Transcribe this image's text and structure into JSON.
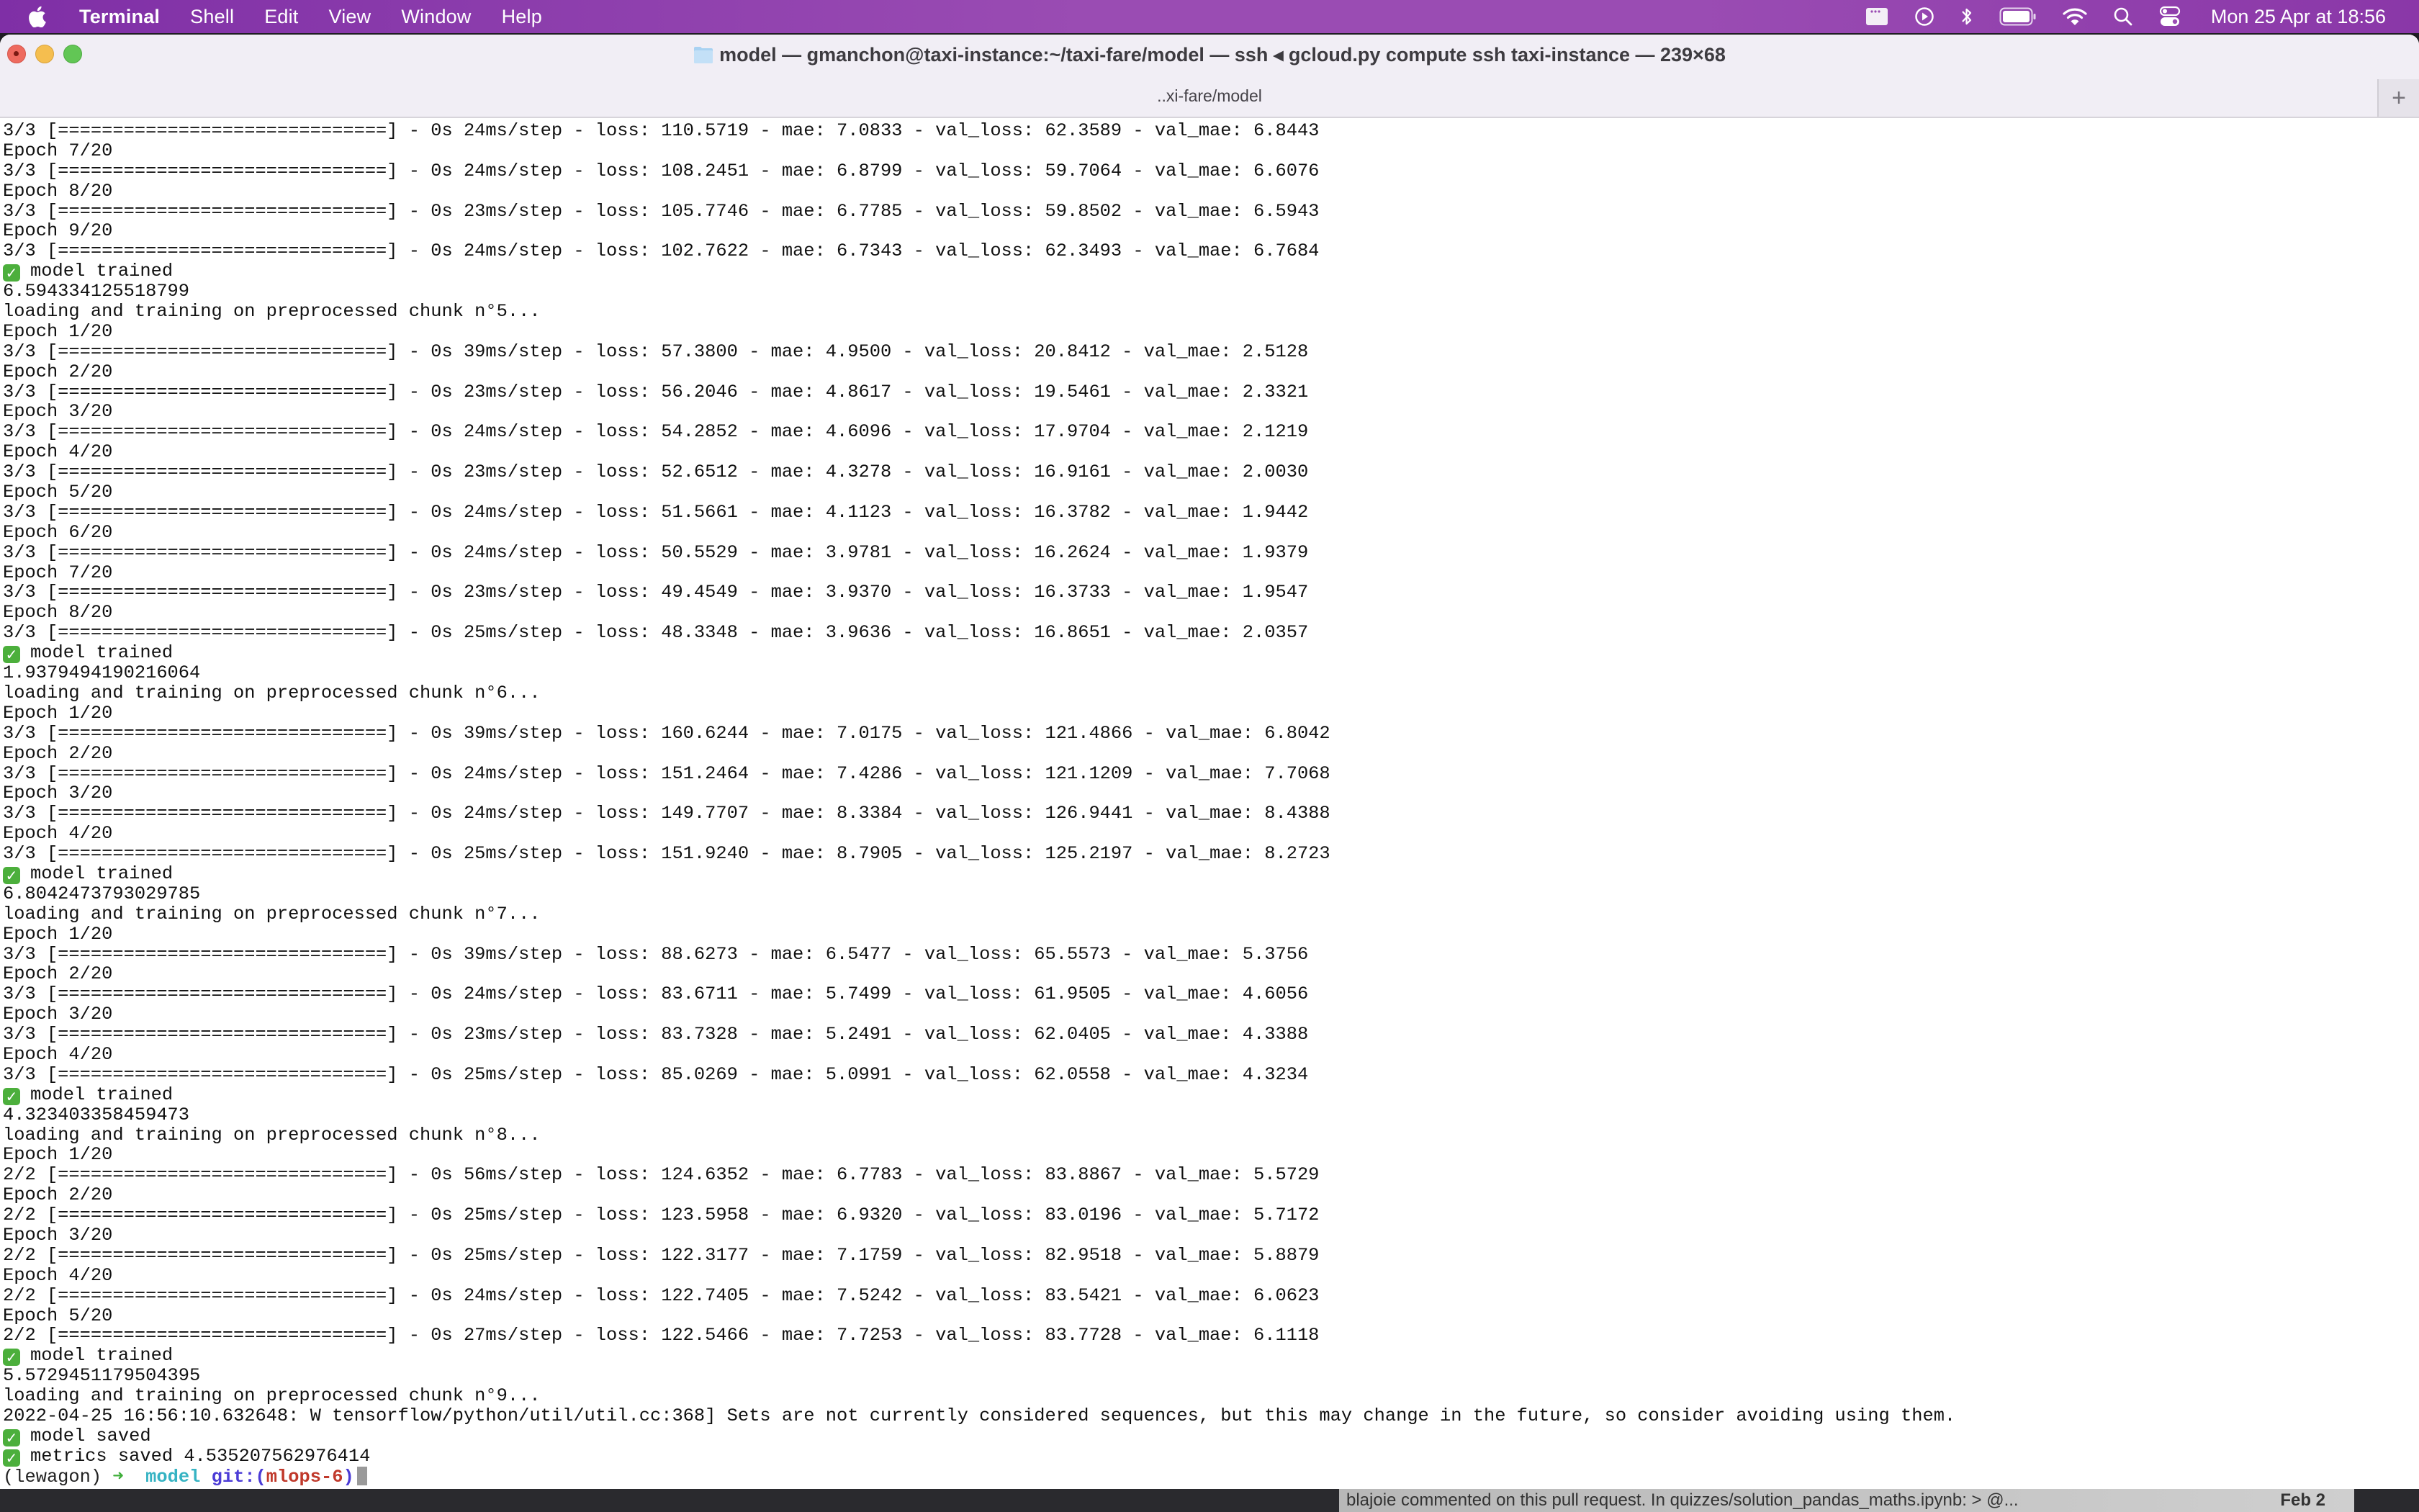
{
  "menubar": {
    "app_name": "Terminal",
    "menus": [
      "Shell",
      "Edit",
      "View",
      "Window",
      "Help"
    ],
    "status_icons": [
      "window-icon",
      "play-circle-icon",
      "bluetooth-icon",
      "battery-icon",
      "wifi-icon",
      "search-icon",
      "control-center-icon"
    ],
    "clock": "Mon 25 Apr at  18:56"
  },
  "window": {
    "title": "model — gmanchon@taxi-instance:~/taxi-fare/model — ssh ◂ gcloud.py compute ssh taxi-instance — 239×68",
    "tab_label": "..xi-fare/model",
    "new_tab_label": "+"
  },
  "terminal": {
    "lines": [
      {
        "text": "3/3 [==============================] - 0s 24ms/step - loss: 110.5719 - mae: 7.0833 - val_loss: 62.3589 - val_mae: 6.8443"
      },
      {
        "text": "Epoch 7/20"
      },
      {
        "text": "3/3 [==============================] - 0s 24ms/step - loss: 108.2451 - mae: 6.8799 - val_loss: 59.7064 - val_mae: 6.6076"
      },
      {
        "text": "Epoch 8/20"
      },
      {
        "text": "3/3 [==============================] - 0s 23ms/step - loss: 105.7746 - mae: 6.7785 - val_loss: 59.8502 - val_mae: 6.5943"
      },
      {
        "text": "Epoch 9/20"
      },
      {
        "text": "3/3 [==============================] - 0s 24ms/step - loss: 102.7622 - mae: 6.7343 - val_loss: 62.3493 - val_mae: 6.7684"
      },
      {
        "text": "model trained",
        "check": true
      },
      {
        "text": "6.594334125518799"
      },
      {
        "text": "loading and training on preprocessed chunk n°5..."
      },
      {
        "text": "Epoch 1/20"
      },
      {
        "text": "3/3 [==============================] - 0s 39ms/step - loss: 57.3800 - mae: 4.9500 - val_loss: 20.8412 - val_mae: 2.5128"
      },
      {
        "text": "Epoch 2/20"
      },
      {
        "text": "3/3 [==============================] - 0s 23ms/step - loss: 56.2046 - mae: 4.8617 - val_loss: 19.5461 - val_mae: 2.3321"
      },
      {
        "text": "Epoch 3/20"
      },
      {
        "text": "3/3 [==============================] - 0s 24ms/step - loss: 54.2852 - mae: 4.6096 - val_loss: 17.9704 - val_mae: 2.1219"
      },
      {
        "text": "Epoch 4/20"
      },
      {
        "text": "3/3 [==============================] - 0s 23ms/step - loss: 52.6512 - mae: 4.3278 - val_loss: 16.9161 - val_mae: 2.0030"
      },
      {
        "text": "Epoch 5/20"
      },
      {
        "text": "3/3 [==============================] - 0s 24ms/step - loss: 51.5661 - mae: 4.1123 - val_loss: 16.3782 - val_mae: 1.9442"
      },
      {
        "text": "Epoch 6/20"
      },
      {
        "text": "3/3 [==============================] - 0s 24ms/step - loss: 50.5529 - mae: 3.9781 - val_loss: 16.2624 - val_mae: 1.9379"
      },
      {
        "text": "Epoch 7/20"
      },
      {
        "text": "3/3 [==============================] - 0s 23ms/step - loss: 49.4549 - mae: 3.9370 - val_loss: 16.3733 - val_mae: 1.9547"
      },
      {
        "text": "Epoch 8/20"
      },
      {
        "text": "3/3 [==============================] - 0s 25ms/step - loss: 48.3348 - mae: 3.9636 - val_loss: 16.8651 - val_mae: 2.0357"
      },
      {
        "text": "model trained",
        "check": true
      },
      {
        "text": "1.9379494190216064"
      },
      {
        "text": "loading and training on preprocessed chunk n°6..."
      },
      {
        "text": "Epoch 1/20"
      },
      {
        "text": "3/3 [==============================] - 0s 39ms/step - loss: 160.6244 - mae: 7.0175 - val_loss: 121.4866 - val_mae: 6.8042"
      },
      {
        "text": "Epoch 2/20"
      },
      {
        "text": "3/3 [==============================] - 0s 24ms/step - loss: 151.2464 - mae: 7.4286 - val_loss: 121.1209 - val_mae: 7.7068"
      },
      {
        "text": "Epoch 3/20"
      },
      {
        "text": "3/3 [==============================] - 0s 24ms/step - loss: 149.7707 - mae: 8.3384 - val_loss: 126.9441 - val_mae: 8.4388"
      },
      {
        "text": "Epoch 4/20"
      },
      {
        "text": "3/3 [==============================] - 0s 25ms/step - loss: 151.9240 - mae: 8.7905 - val_loss: 125.2197 - val_mae: 8.2723"
      },
      {
        "text": "model trained",
        "check": true
      },
      {
        "text": "6.8042473793029785"
      },
      {
        "text": "loading and training on preprocessed chunk n°7..."
      },
      {
        "text": "Epoch 1/20"
      },
      {
        "text": "3/3 [==============================] - 0s 39ms/step - loss: 88.6273 - mae: 6.5477 - val_loss: 65.5573 - val_mae: 5.3756"
      },
      {
        "text": "Epoch 2/20"
      },
      {
        "text": "3/3 [==============================] - 0s 24ms/step - loss: 83.6711 - mae: 5.7499 - val_loss: 61.9505 - val_mae: 4.6056"
      },
      {
        "text": "Epoch 3/20"
      },
      {
        "text": "3/3 [==============================] - 0s 23ms/step - loss: 83.7328 - mae: 5.2491 - val_loss: 62.0405 - val_mae: 4.3388"
      },
      {
        "text": "Epoch 4/20"
      },
      {
        "text": "3/3 [==============================] - 0s 25ms/step - loss: 85.0269 - mae: 5.0991 - val_loss: 62.0558 - val_mae: 4.3234"
      },
      {
        "text": "model trained",
        "check": true
      },
      {
        "text": "4.323403358459473"
      },
      {
        "text": "loading and training on preprocessed chunk n°8..."
      },
      {
        "text": "Epoch 1/20"
      },
      {
        "text": "2/2 [==============================] - 0s 56ms/step - loss: 124.6352 - mae: 6.7783 - val_loss: 83.8867 - val_mae: 5.5729"
      },
      {
        "text": "Epoch 2/20"
      },
      {
        "text": "2/2 [==============================] - 0s 25ms/step - loss: 123.5958 - mae: 6.9320 - val_loss: 83.0196 - val_mae: 5.7172"
      },
      {
        "text": "Epoch 3/20"
      },
      {
        "text": "2/2 [==============================] - 0s 25ms/step - loss: 122.3177 - mae: 7.1759 - val_loss: 82.9518 - val_mae: 5.8879"
      },
      {
        "text": "Epoch 4/20"
      },
      {
        "text": "2/2 [==============================] - 0s 24ms/step - loss: 122.7405 - mae: 7.5242 - val_loss: 83.5421 - val_mae: 6.0623"
      },
      {
        "text": "Epoch 5/20"
      },
      {
        "text": "2/2 [==============================] - 0s 27ms/step - loss: 122.5466 - mae: 7.7253 - val_loss: 83.7728 - val_mae: 6.1118"
      },
      {
        "text": "model trained",
        "check": true
      },
      {
        "text": "5.5729451179504395"
      },
      {
        "text": "loading and training on preprocessed chunk n°9..."
      },
      {
        "text": "2022-04-25 16:56:10.632648: W tensorflow/python/util/util.cc:368] Sets are not currently considered sequences, but this may change in the future, so consider avoiding using them."
      },
      {
        "text": "model saved",
        "check": true
      },
      {
        "text": "metrics saved 4.535207562976414",
        "check": true
      }
    ],
    "prompt": {
      "env": "(lewagon)",
      "arrow": "➜",
      "dir": "model",
      "git_prefix": "git:(",
      "branch": "mlops-6",
      "git_suffix": ")"
    }
  },
  "background": {
    "notification_text": "blajoie commented on this pull request. In quizzes/solution_pandas_maths.ipynb: > @...",
    "notification_date": "Feb 2"
  }
}
